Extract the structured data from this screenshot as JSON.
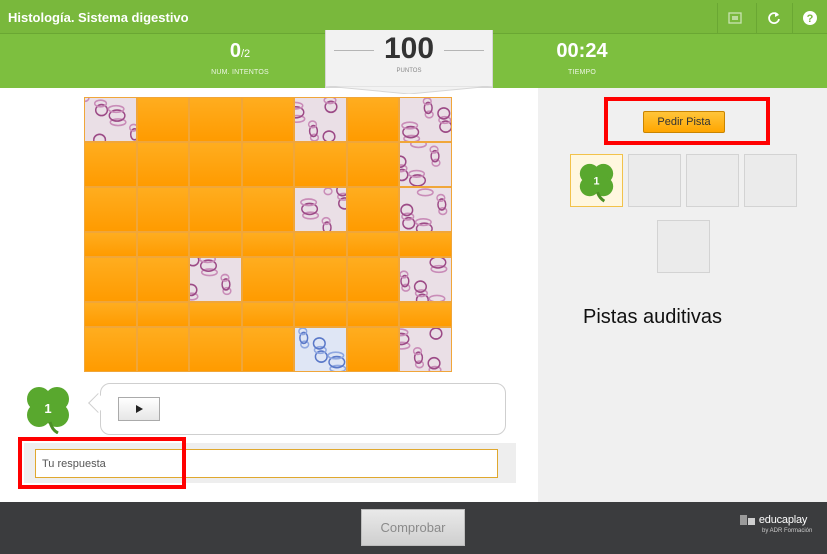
{
  "header": {
    "title": "Histología. Sistema digestivo",
    "attempts": {
      "value": "0",
      "total": "/2",
      "caption": "NUM. INTENTOS"
    },
    "score": {
      "value": "100",
      "caption": "PUNTOS"
    },
    "time": {
      "value": "00:24",
      "caption": "TIEMPO"
    }
  },
  "puzzle": {
    "rows": 7,
    "cols": 7,
    "revealed_tiles": [
      [
        0,
        0
      ],
      [
        0,
        4
      ],
      [
        0,
        6
      ],
      [
        1,
        6
      ],
      [
        2,
        4
      ],
      [
        2,
        6
      ],
      [
        4,
        2
      ],
      [
        4,
        6
      ],
      [
        6,
        4
      ],
      [
        6,
        6
      ]
    ],
    "revealed_colors": [
      "#eadfe6",
      "#dfe6f5"
    ]
  },
  "clue": {
    "clover_number": "1",
    "play_icon": "play-icon"
  },
  "answer": {
    "placeholder": "Tu respuesta"
  },
  "hints": {
    "button_label": "Pedir Pista",
    "slot_1_number": "1",
    "section_label": "Pistas auditivas"
  },
  "footer": {
    "check_label": "Comprobar",
    "brand_name": "educaplay",
    "brand_sub": "by ADR Formación"
  },
  "colors": {
    "header_green": "#7dbf3f",
    "tile_orange": "#ff9b00",
    "annotation_red": "#ff0000",
    "footer_dark": "#3b3c3e"
  }
}
